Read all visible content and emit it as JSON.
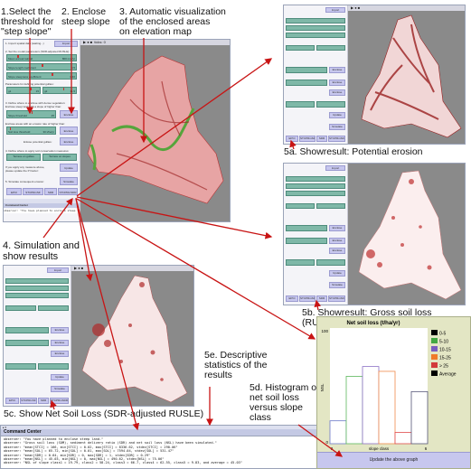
{
  "annotations": {
    "step1": "1.Select the\nthreshold for\n\"step slope\"",
    "step2": "2. Enclose\nsteep slope",
    "step3": "3. Automatic visualization\nof the enclosed areas\non elevation map",
    "step4": "4. Simulation and\nshow results",
    "step5a": "5a. Showresult: Potential erosion",
    "step5b": "5b. Showresult: Gross soil loss (RUSLE)",
    "step5c": "5c. Show Net Soil Loss (SDR-adjusted RUSLE)",
    "step5d": "5d. Histogram of\nnet soil loss\nversus slope\nclass",
    "step5e": "5e. Descriptive\nstatistics of the\nresults"
  },
  "panel": {
    "import_label": "1. Import spatial data (waiting...)",
    "import_button": "Import",
    "params_heading": "2. Set the model parameters (SDR-adjusted RUSLE):",
    "sliders": [
      {
        "label": "Mean annual rainfall",
        "value": "800 mm/yr",
        "fraction": 0.15
      },
      {
        "label": "Slope length coefficient",
        "value": "0.5",
        "fraction": 0.5
      },
      {
        "label": "Slope steepness coefficient",
        "value": "1.40",
        "fraction": 0.65
      }
    ],
    "gully_heading": "Parameters for defining potential gullies:",
    "gully_sliders": [
      {
        "label": "g1",
        "value": "15",
        "fraction": 0.7
      },
      {
        "label": "g2",
        "value": "11.5",
        "fraction": 0.6
      }
    ],
    "enclose_heading": "3. Define where to enclose with dense vegetation:\nEnclose steep land with a slope of higher than:",
    "slope_slider": {
      "label": "Slope threshold",
      "value": "25",
      "fraction": 0.5
    },
    "enclose_button": "Enclose",
    "erosion_heading": "Enclose areas with an erosion rate of higher than:",
    "erosion_slider": {
      "label": "Soil loss threshold",
      "value": "30 t/ha/yr",
      "fraction": 0.05
    },
    "enclose_button2": "Enclose",
    "gully_enclose_label": "Enlose potential gullies:",
    "enclose_button3": "Enclose",
    "conservation_heading": "4. Define where to apply soil conservation measures:",
    "terrace_gullies": "Terrace on gullies",
    "terrace_slopes": "Terrace on slopes",
    "update_note": "If you apply any measure above,\nplease update the P Factor:",
    "update_button": "Update",
    "simulate_label": "5. Simulate consequent erosion:",
    "simulate_button": "Simulate",
    "result_buttons": [
      "EPCI",
      "STCPRmSF",
      "SDR",
      "STCPRmSDR"
    ]
  },
  "view": {
    "title": "ticks: 0",
    "speed_icons": "▶ ● ■"
  },
  "command_center": {
    "title": "Command Center",
    "lines": [
      "observer: \"You have planned to enclose steep land.\"",
      "observer: \"Gross soil loss (SOM), sediment delivery ratio (SDR) and net soil loss (NSL) have been simulated.\"",
      "observer: \"mean[STCI] = 166, min[STCI] = 0.02, max[STCI] = 8336.62, stdev[STCI] = 290.06\"",
      "observer: \"mean[SOL] = 65.72, min[SOL] = 0.01, max[SOL] = 7594.04, stdev[SOL] = 531.47\"",
      "observer: \"mean[SDR] = 0.64, min[SDR] = 0, max[SDR] = 1, stdev[SDR] = 0.29\"",
      "observer: \"mean[NSL] = 45.03, min[NSL] = 0, max[NSL] = 490.62, stdev[NSL] = 75.06\"",
      "observer: \"NSL of slope class1 = 19.79, class2 = 58.24, class3 = 66.7, class4 = 62.55, class5 = 9.83, and average = 45.03\""
    ]
  },
  "chart_data": {
    "type": "bar",
    "title": "Net soil loss (t/ha/yr)",
    "xlabel": "slope class",
    "ylabel": "NSL",
    "xlim": [
      0,
      6
    ],
    "ylim": [
      0,
      100
    ],
    "x_ticks": [
      "0",
      "6"
    ],
    "y_ticks": [
      "0",
      "100"
    ],
    "categories": [
      "0-5",
      "5-10",
      "10-15",
      "15-25",
      "> 25",
      "Average"
    ],
    "values": [
      19.79,
      58.24,
      66.7,
      62.55,
      9.83,
      45.03
    ],
    "colors": [
      "#6b78c8",
      "#5cb85c",
      "#8a6fc4",
      "#f08a4b",
      "#e04a4a",
      "#555577"
    ],
    "legend": [
      {
        "label": "0-5",
        "color": "#000000"
      },
      {
        "label": "5-10",
        "color": "#43a843"
      },
      {
        "label": "10-15",
        "color": "#7a5cc0"
      },
      {
        "label": "15-25",
        "color": "#f07a2a"
      },
      {
        "label": "> 25",
        "color": "#d23a3a"
      },
      {
        "label": "Average",
        "color": "#000000"
      }
    ],
    "legend_position": "right",
    "button_label": "Update the above graph"
  }
}
